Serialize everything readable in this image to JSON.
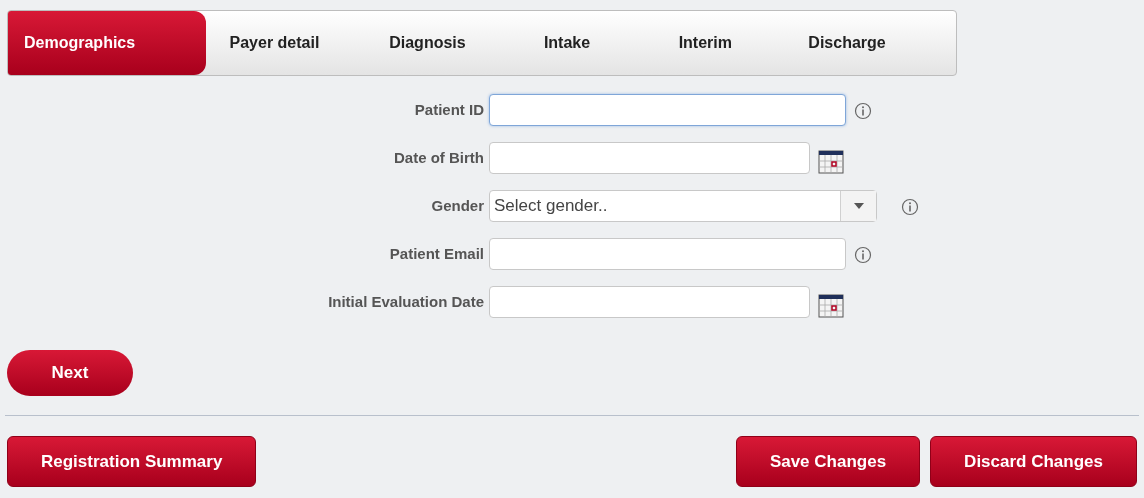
{
  "tabs": [
    {
      "label": "Demographics",
      "selected": true
    },
    {
      "label": "Payer detail",
      "selected": false
    },
    {
      "label": "Diagnosis",
      "selected": false
    },
    {
      "label": "Intake",
      "selected": false
    },
    {
      "label": "Interim",
      "selected": false
    },
    {
      "label": "Discharge",
      "selected": false
    }
  ],
  "fields": [
    {
      "label": "Patient ID",
      "kind": "text",
      "info": true,
      "focused": true
    },
    {
      "label": "Date of Birth",
      "kind": "date",
      "info": false,
      "focused": false
    },
    {
      "label": "Gender",
      "kind": "select",
      "placeholder": "Select gender..",
      "info": true,
      "focused": false
    },
    {
      "label": "Patient Email",
      "kind": "text",
      "info": true,
      "focused": false
    },
    {
      "label": "Initial Evaluation Date",
      "kind": "date",
      "info": false,
      "focused": false
    }
  ],
  "next_button": "Next",
  "left_buttons": [
    "Registration Summary"
  ],
  "right_buttons": [
    "Save Changes",
    "Discard Changes"
  ]
}
